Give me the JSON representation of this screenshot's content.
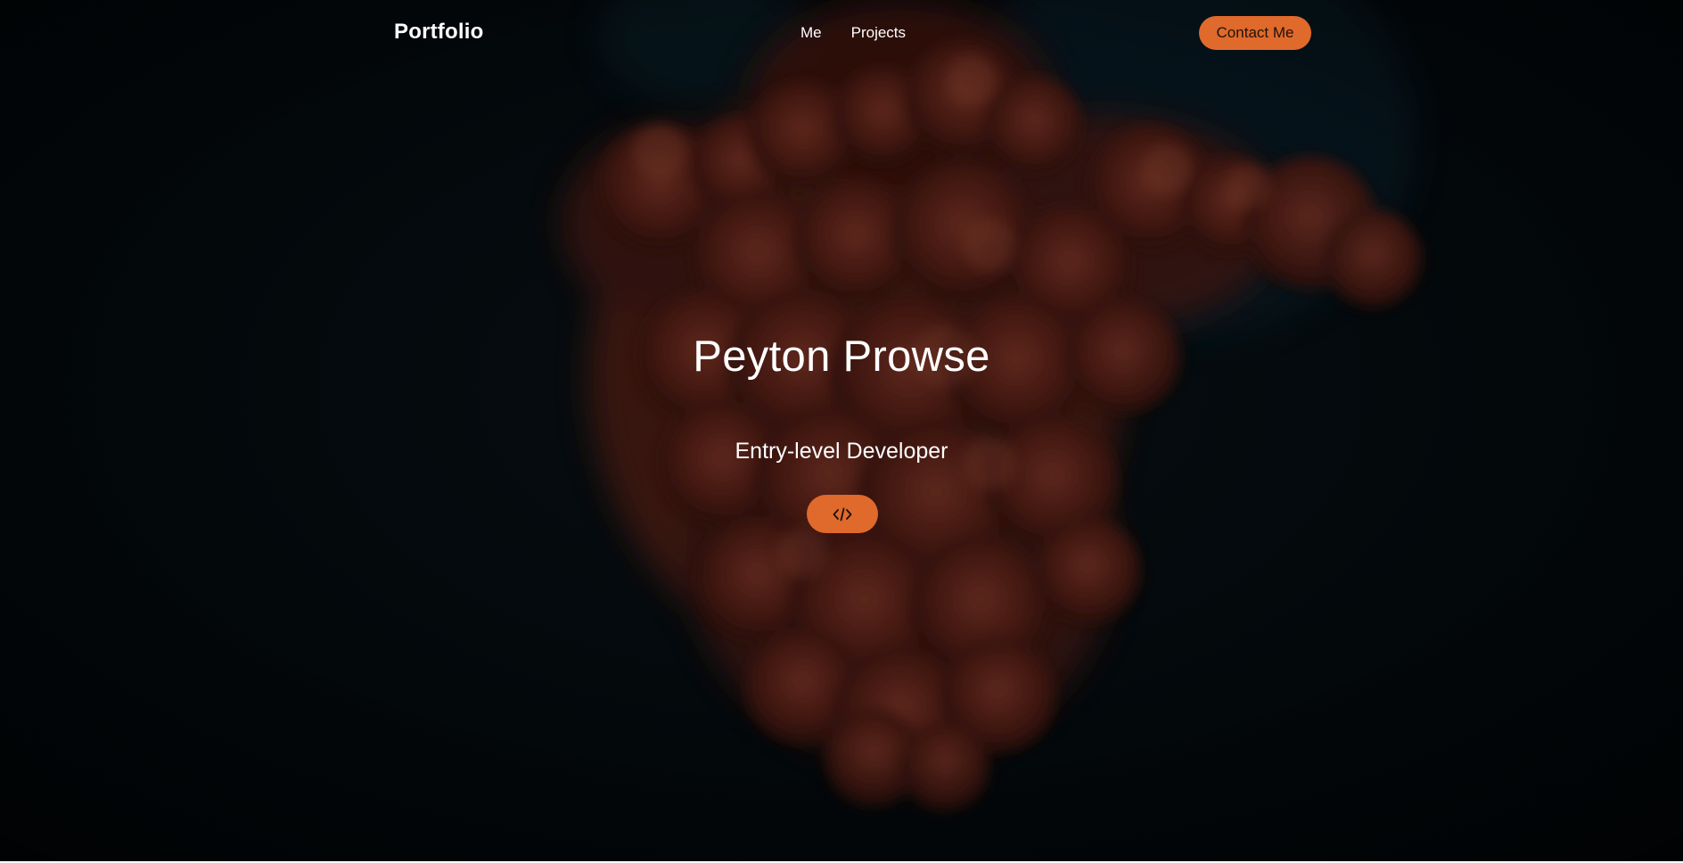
{
  "navbar": {
    "brand": "Portfolio",
    "links": [
      {
        "label": "Me"
      },
      {
        "label": "Projects"
      }
    ],
    "contact_label": "Contact Me"
  },
  "hero": {
    "name": "Peyton Prowse",
    "role": "Entry-level Developer",
    "cta_icon": "code-icon",
    "background_image": "red-orange ink smoke on dark background"
  },
  "colors": {
    "accent": "#e0692c",
    "background": "#050c10",
    "text": "#ffffff"
  }
}
